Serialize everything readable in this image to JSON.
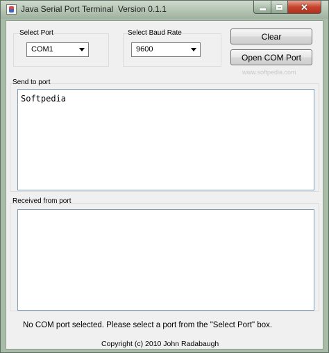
{
  "window": {
    "title": "Java Serial Port Terminal  Version 0.1.1",
    "icon": "java-app-icon"
  },
  "port": {
    "label": "Select Port",
    "selected": "COM1"
  },
  "baud": {
    "label": "Select Baud Rate",
    "selected": "9600"
  },
  "buttons": {
    "clear": "Clear",
    "open_port": "Open COM Port"
  },
  "send": {
    "label": "Send to port",
    "value": "Softpedia"
  },
  "receive": {
    "label": "Received from port",
    "value": ""
  },
  "status": "No COM port selected.  Please select a port from the \"Select Port\" box.",
  "footer": "Copyright (c) 2010 John Radabaugh",
  "watermark": "www.softpedia.com"
}
